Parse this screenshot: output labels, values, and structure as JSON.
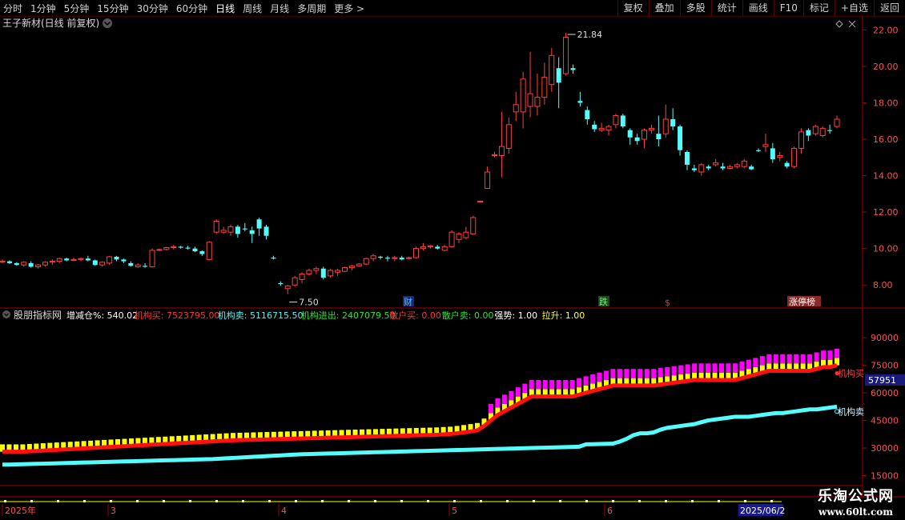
{
  "toolbar": {
    "periods": [
      "分时",
      "1分钟",
      "5分钟",
      "15分钟",
      "30分钟",
      "60分钟",
      "日线",
      "周线",
      "月线",
      "多周期",
      "更多 >"
    ],
    "active_period": "日线",
    "actions": [
      "复权",
      "叠加",
      "多股",
      "统计",
      "画线",
      "F10",
      "标记",
      "+自选",
      "返回"
    ]
  },
  "price_panel": {
    "title": "王子新材(日线 前复权)",
    "high_label": "21.84",
    "low_label": "7.50",
    "yticks": [
      "22.00",
      "20.00",
      "18.00",
      "16.00",
      "14.00",
      "12.00",
      "10.00",
      "8.00"
    ],
    "event_markers": [
      "财",
      "跌",
      "$",
      "涨停榜"
    ]
  },
  "indicator_panel": {
    "name": "股朋指标网",
    "params": [
      {
        "label": "增减仓%: 540.02",
        "color": "#ffffff"
      },
      {
        "label": "机构买: 7523795.00",
        "color": "#ff3030"
      },
      {
        "label": "机构卖: 5116715.50",
        "color": "#5ff0f0"
      },
      {
        "label": "机构进出: 2407079.50",
        "color": "#30e030"
      },
      {
        "label": "散户买: 0.00",
        "color": "#ff3030"
      },
      {
        "label": "散户卖: 0.00",
        "color": "#30e030"
      },
      {
        "label": "强势: 1.00",
        "color": "#ffffff"
      },
      {
        "label": "拉升: 1.00",
        "color": "#ffff40"
      }
    ],
    "yticks": [
      "90000",
      "75000",
      "60000",
      "45000",
      "30000",
      "15000"
    ],
    "current_value": "57951",
    "buy_line_label": "机构买",
    "sell_line_label": "机构卖"
  },
  "date_axis": {
    "labels": [
      "2025年",
      "3",
      "4",
      "5",
      "6"
    ],
    "current_date": "2025/06/2"
  },
  "colors": {
    "up": "#ff4040",
    "down": "#54fcfc",
    "buy_line": "#ff1010",
    "sell_line": "#54fcfc",
    "yellow_bar": "#ffff00",
    "magenta_bar": "#ff00ff",
    "axis": "#a00000"
  },
  "watermark": {
    "line1": "乐淘公式网",
    "line2": "www.60lt.com"
  },
  "chart_data": [
    {
      "type": "candlestick",
      "title": "王子新材(日线 前复权)",
      "ylim": [
        7.0,
        22.5
      ],
      "candles": [
        [
          9.3,
          9.4,
          9.2,
          9.3
        ],
        [
          9.3,
          9.35,
          9.15,
          9.2
        ],
        [
          9.2,
          9.25,
          9.05,
          9.1
        ],
        [
          9.1,
          9.3,
          9.0,
          9.25
        ],
        [
          9.2,
          9.3,
          8.95,
          9.0
        ],
        [
          9.0,
          9.15,
          8.9,
          9.1
        ],
        [
          9.1,
          9.3,
          9.0,
          9.25
        ],
        [
          9.25,
          9.4,
          9.1,
          9.3
        ],
        [
          9.3,
          9.5,
          9.2,
          9.45
        ],
        [
          9.45,
          9.5,
          9.3,
          9.35
        ],
        [
          9.35,
          9.5,
          9.3,
          9.4
        ],
        [
          9.4,
          9.5,
          9.3,
          9.45
        ],
        [
          9.45,
          9.6,
          9.3,
          9.35
        ],
        [
          9.35,
          9.4,
          9.05,
          9.1
        ],
        [
          9.1,
          9.3,
          9.0,
          9.25
        ],
        [
          9.2,
          9.6,
          9.1,
          9.55
        ],
        [
          9.55,
          9.6,
          9.3,
          9.4
        ],
        [
          9.4,
          9.45,
          9.2,
          9.3
        ],
        [
          9.2,
          9.3,
          9.0,
          9.05
        ],
        [
          9.0,
          9.2,
          8.95,
          9.1
        ],
        [
          9.05,
          9.2,
          8.95,
          9.0
        ],
        [
          9.0,
          10.0,
          8.95,
          9.9
        ],
        [
          9.9,
          10.0,
          9.85,
          9.95
        ],
        [
          9.95,
          10.1,
          9.9,
          10.05
        ],
        [
          10.05,
          10.2,
          9.95,
          10.1
        ],
        [
          10.1,
          10.15,
          10.0,
          10.05
        ],
        [
          10.05,
          10.15,
          9.95,
          10.0
        ],
        [
          10.0,
          10.1,
          9.8,
          9.85
        ],
        [
          9.85,
          9.9,
          9.6,
          9.7
        ],
        [
          9.4,
          10.4,
          9.35,
          10.35
        ],
        [
          10.9,
          11.6,
          10.8,
          11.5
        ],
        [
          10.9,
          11.2,
          10.8,
          11.0
        ],
        [
          10.9,
          11.3,
          10.7,
          11.2
        ],
        [
          11.2,
          11.3,
          10.6,
          10.8
        ],
        [
          11.1,
          11.4,
          10.95,
          11.05
        ],
        [
          11.0,
          11.2,
          10.3,
          10.8
        ],
        [
          11.6,
          11.7,
          10.7,
          11.1
        ],
        [
          11.2,
          11.3,
          10.5,
          10.7
        ],
        [
          9.5,
          9.6,
          9.4,
          9.45
        ],
        [
          8.1,
          8.2,
          7.95,
          8.05
        ],
        [
          7.8,
          8.0,
          7.5,
          7.95
        ],
        [
          8.0,
          8.5,
          7.9,
          8.4
        ],
        [
          8.3,
          8.7,
          8.1,
          8.6
        ],
        [
          8.6,
          8.9,
          8.5,
          8.8
        ],
        [
          8.8,
          9.0,
          8.6,
          8.9
        ],
        [
          8.9,
          9.0,
          8.3,
          8.4
        ],
        [
          8.5,
          8.9,
          8.4,
          8.8
        ],
        [
          8.7,
          8.9,
          8.5,
          8.8
        ],
        [
          8.75,
          9.0,
          8.7,
          8.95
        ],
        [
          8.95,
          9.1,
          8.8,
          9.05
        ],
        [
          9.05,
          9.2,
          9.0,
          9.15
        ],
        [
          9.15,
          9.5,
          9.1,
          9.45
        ],
        [
          9.45,
          9.7,
          9.3,
          9.6
        ],
        [
          9.55,
          9.6,
          9.4,
          9.5
        ],
        [
          9.5,
          9.6,
          9.3,
          9.45
        ],
        [
          9.45,
          9.6,
          9.3,
          9.5
        ],
        [
          9.5,
          9.6,
          9.35,
          9.4
        ],
        [
          9.45,
          9.55,
          9.4,
          9.5
        ],
        [
          9.5,
          10.1,
          9.45,
          10.0
        ],
        [
          10.0,
          10.3,
          9.9,
          10.1
        ],
        [
          10.1,
          10.2,
          10.0,
          10.15
        ],
        [
          10.1,
          10.2,
          9.95,
          10.0
        ],
        [
          9.9,
          10.2,
          9.85,
          10.1
        ],
        [
          10.1,
          11.0,
          10.05,
          10.9
        ],
        [
          10.5,
          10.9,
          10.3,
          10.8
        ],
        [
          10.6,
          11.2,
          10.5,
          10.9
        ],
        [
          10.8,
          11.8,
          10.8,
          11.7
        ],
        [
          12.6,
          12.6,
          12.6,
          12.6
        ],
        [
          13.3,
          14.5,
          13.3,
          14.2
        ],
        [
          15.1,
          15.3,
          15.0,
          15.15
        ],
        [
          15.1,
          17.5,
          13.9,
          15.6
        ],
        [
          15.5,
          17.2,
          15.2,
          16.8
        ],
        [
          17.5,
          18.6,
          17.0,
          17.9
        ],
        [
          17.5,
          19.7,
          16.6,
          19.3
        ],
        [
          17.8,
          20.8,
          17.2,
          18.5
        ],
        [
          17.8,
          19.6,
          17.3,
          18.3
        ],
        [
          18.3,
          20.2,
          17.9,
          19.4
        ],
        [
          19.0,
          21.0,
          18.6,
          20.6
        ],
        [
          19.9,
          20.5,
          17.7,
          19.1
        ],
        [
          19.6,
          21.84,
          19.5,
          21.6
        ],
        [
          19.9,
          20.1,
          19.6,
          19.8
        ],
        [
          18.1,
          18.6,
          17.8,
          18.0
        ],
        [
          17.6,
          17.8,
          16.8,
          17.1
        ],
        [
          16.8,
          17.0,
          16.4,
          16.55
        ],
        [
          16.5,
          16.9,
          16.4,
          16.6
        ],
        [
          16.5,
          16.8,
          16.2,
          16.7
        ],
        [
          16.8,
          17.4,
          16.6,
          17.3
        ],
        [
          17.3,
          17.4,
          16.6,
          16.7
        ],
        [
          16.5,
          16.6,
          15.7,
          16.1
        ],
        [
          16.1,
          16.3,
          15.7,
          15.9
        ],
        [
          16.0,
          16.6,
          15.5,
          16.5
        ],
        [
          16.5,
          16.8,
          16.3,
          16.6
        ],
        [
          16.3,
          17.3,
          15.6,
          16.0
        ],
        [
          16.3,
          17.9,
          16.1,
          17.1
        ],
        [
          17.1,
          17.7,
          16.5,
          16.7
        ],
        [
          16.7,
          16.8,
          15.1,
          15.4
        ],
        [
          15.3,
          15.4,
          14.3,
          14.6
        ],
        [
          14.4,
          14.6,
          14.2,
          14.3
        ],
        [
          14.2,
          14.7,
          14.0,
          14.6
        ],
        [
          14.5,
          14.6,
          14.3,
          14.4
        ],
        [
          14.6,
          14.9,
          14.5,
          14.7
        ],
        [
          14.5,
          14.7,
          14.3,
          14.4
        ],
        [
          14.4,
          14.6,
          14.35,
          14.5
        ],
        [
          14.5,
          14.7,
          14.4,
          14.6
        ],
        [
          14.5,
          14.9,
          14.4,
          14.8
        ],
        [
          14.5,
          14.6,
          14.3,
          14.35
        ],
        [
          15.4,
          15.5,
          15.3,
          15.35
        ],
        [
          15.6,
          16.3,
          15.3,
          15.7
        ],
        [
          15.5,
          15.8,
          14.7,
          14.9
        ],
        [
          15.0,
          15.3,
          14.8,
          15.1
        ],
        [
          14.7,
          14.8,
          14.4,
          14.5
        ],
        [
          14.5,
          15.6,
          14.4,
          15.5
        ],
        [
          15.5,
          16.6,
          15.2,
          16.4
        ],
        [
          16.5,
          16.6,
          15.9,
          16.2
        ],
        [
          16.3,
          16.8,
          16.2,
          16.7
        ],
        [
          16.2,
          16.7,
          16.1,
          16.6
        ],
        [
          16.5,
          16.8,
          16.3,
          16.45
        ],
        [
          16.7,
          17.3,
          16.6,
          17.1
        ]
      ]
    },
    {
      "type": "line",
      "title": "股朋指标网",
      "ylim": [
        10000,
        97000
      ],
      "series": [
        {
          "name": "机构买",
          "values": [
            28000,
            28000,
            28000,
            28000,
            28200,
            28400,
            28600,
            28800,
            29000,
            29200,
            29400,
            29600,
            29800,
            30000,
            30200,
            30400,
            30600,
            30800,
            31000,
            31200,
            31400,
            31600,
            31800,
            32000,
            32200,
            32400,
            32600,
            32800,
            33000,
            33200,
            33400,
            33600,
            33800,
            34000,
            34200,
            34300,
            34400,
            34500,
            34600,
            34700,
            34800,
            34900,
            35000,
            35100,
            35200,
            35300,
            35400,
            35500,
            35600,
            35700,
            35800,
            35900,
            36000,
            36100,
            36200,
            36300,
            36400,
            36500,
            36600,
            36700,
            36800,
            36900,
            37000,
            37100,
            37200,
            37400,
            37600,
            38000,
            38500,
            39000,
            39600,
            42000,
            45000,
            48000,
            50000,
            52000,
            54000,
            56000,
            58000,
            58000,
            58000,
            58000,
            58000,
            58000,
            58000,
            59000,
            60000,
            61000,
            62000,
            63000,
            64000,
            64000,
            64000,
            64000,
            64000,
            64000,
            64000,
            64500,
            65000,
            65500,
            66000,
            66500,
            67000,
            67000,
            67000,
            67000,
            67000,
            67000,
            67000,
            68000,
            69000,
            70000,
            71000,
            72000,
            72000,
            72000,
            72000,
            72000,
            72000,
            72000,
            73000,
            74000,
            74000,
            75000
          ]
        },
        {
          "name": "机构卖",
          "values": [
            21000,
            21000,
            21100,
            21200,
            21300,
            21400,
            21500,
            21600,
            21700,
            21800,
            21900,
            22000,
            22100,
            22200,
            22300,
            22400,
            22500,
            22600,
            22700,
            22800,
            22900,
            23000,
            23100,
            23200,
            23300,
            23400,
            23500,
            23600,
            23700,
            23800,
            23900,
            24000,
            24200,
            24400,
            24600,
            24800,
            25000,
            25200,
            25400,
            25600,
            25800,
            26000,
            26200,
            26400,
            26600,
            26700,
            26800,
            26900,
            27000,
            27100,
            27200,
            27300,
            27400,
            27500,
            27600,
            27700,
            27800,
            27900,
            28000,
            28100,
            28200,
            28300,
            28400,
            28500,
            28600,
            28700,
            28800,
            28900,
            29000,
            29100,
            29200,
            29300,
            29400,
            29500,
            29600,
            29700,
            29800,
            29900,
            30000,
            30100,
            30200,
            30300,
            30400,
            30500,
            30600,
            30700,
            32000,
            32100,
            32200,
            32300,
            32400,
            33500,
            35000,
            37000,
            38000,
            38000,
            38500,
            40000,
            41000,
            41500,
            42000,
            42500,
            43000,
            44000,
            45000,
            45500,
            46000,
            46500,
            47000,
            47000,
            47000,
            47500,
            48000,
            48500,
            49000,
            49000,
            49500,
            50000,
            50500,
            51000,
            51000,
            51500,
            52000,
            52500,
            52000
          ]
        }
      ]
    }
  ]
}
